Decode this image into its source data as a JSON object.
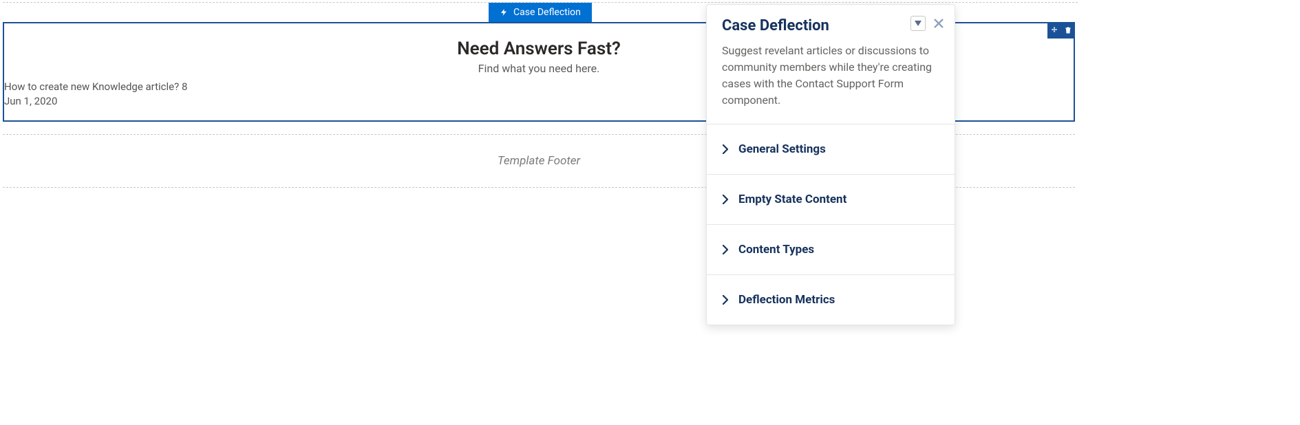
{
  "component_tab": {
    "label": "Case Deflection"
  },
  "component": {
    "heading": "Need Answers Fast?",
    "subheading": "Find what you need here.",
    "results": [
      {
        "title": "How to create new Knowledge article? 8",
        "date": "Jun 1, 2020"
      }
    ]
  },
  "footer": {
    "label": "Template Footer"
  },
  "panel": {
    "title": "Case Deflection",
    "description": "Suggest revelant articles or discussions to community members while they're creating cases with the Contact Support Form component.",
    "sections": [
      {
        "label": "General Settings"
      },
      {
        "label": "Empty State Content"
      },
      {
        "label": "Content Types"
      },
      {
        "label": "Deflection Metrics"
      }
    ]
  }
}
